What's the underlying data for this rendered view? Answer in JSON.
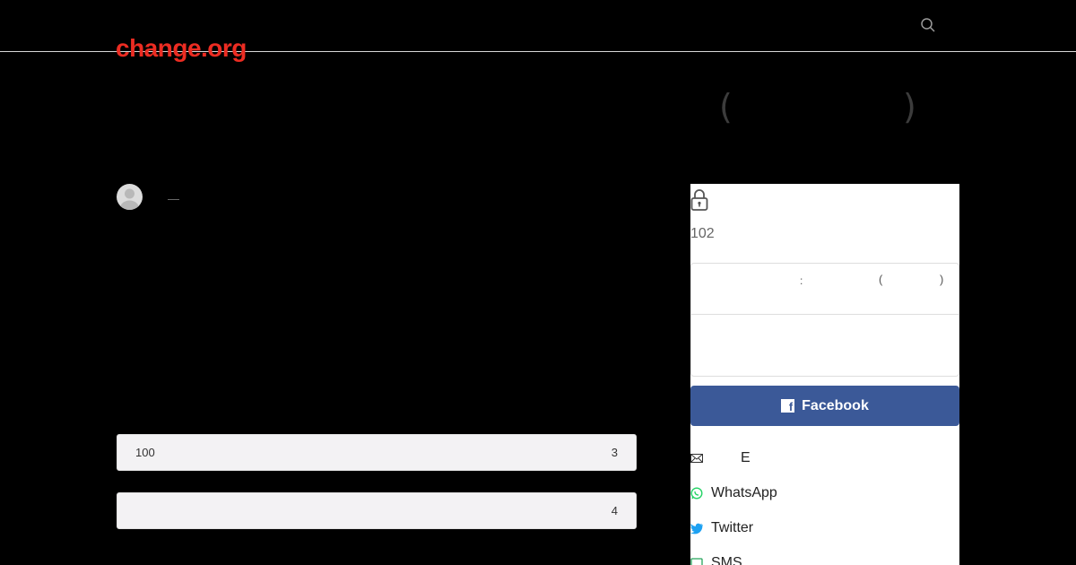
{
  "header": {
    "logo": "change.org",
    "search_icon": "search-icon"
  },
  "hero": {
    "paren_open": "(",
    "paren_close": ")"
  },
  "author": {
    "dash": "—"
  },
  "progress": [
    {
      "left": "100",
      "right": "3"
    },
    {
      "left": "",
      "right": "4"
    }
  ],
  "sign_panel": {
    "lock_icon": "lock-icon",
    "signature_count": "102",
    "field_colon": ":",
    "field_paren_open": "(",
    "field_paren_close": ")",
    "facebook_label": "Facebook",
    "share": {
      "email_label": "E",
      "whatsapp_label": "WhatsApp",
      "twitter_label": "Twitter",
      "sms_label": "SMS"
    }
  },
  "colors": {
    "brand": "#ec2c22",
    "facebook": "#3b5998",
    "whatsapp": "#25d366",
    "twitter": "#1da1f2"
  }
}
